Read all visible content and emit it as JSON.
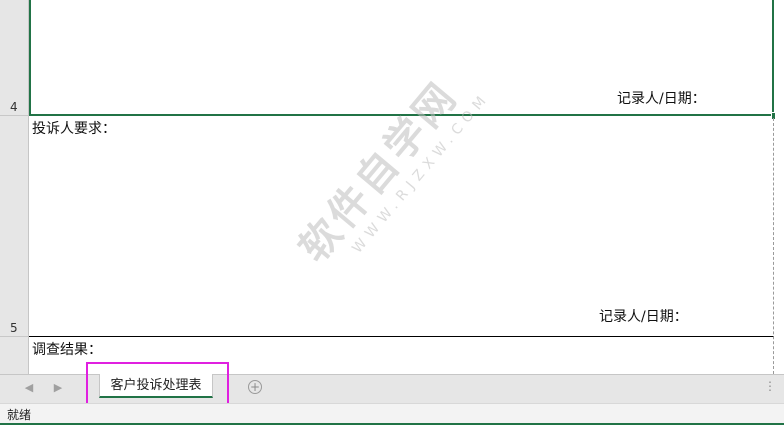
{
  "rows": {
    "row4": {
      "number": "4",
      "recorder_label": "记录人/日期："
    },
    "row5": {
      "number": "5",
      "title": "投诉人要求：",
      "recorder_label": "记录人/日期："
    },
    "row6": {
      "title": "调查结果："
    }
  },
  "watermark": {
    "text_cn": "软件自学网",
    "text_en": "WWW.RJZXW.COM"
  },
  "sheet_tabs": {
    "prev_icon": "chevron-left-icon",
    "next_icon": "chevron-right-icon",
    "active_tab": "客户投诉处理表",
    "add_icon": "plus-circle-icon",
    "more_icon": "vertical-ellipsis-icon"
  },
  "status_bar": {
    "status": "就绪"
  },
  "colors": {
    "accent": "#217346",
    "highlight": "#e020e0"
  }
}
